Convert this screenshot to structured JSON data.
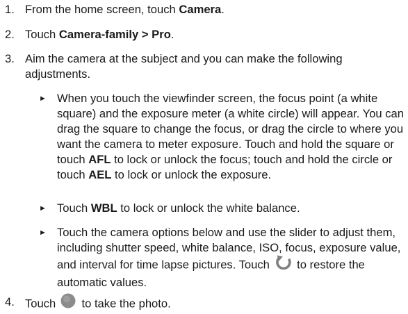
{
  "steps": [
    {
      "number": "1.",
      "t1": "From the home screen, touch ",
      "b1": "Camera",
      "t2": "."
    },
    {
      "number": "2.",
      "t1": "Touch ",
      "b1": "Camera-family > Pro",
      "t2": "."
    },
    {
      "number": "3.",
      "text": "Aim the camera at the subject and you can make the following adjustments."
    },
    {
      "number": "4.",
      "t1": "Touch ",
      "t2": " to take the photo.",
      "icon": "shutter-button-icon"
    }
  ],
  "bullets": [
    {
      "t1": "When you touch the viewfinder screen, the focus point (a white square) and the exposure meter (a white circle) will appear. You can drag the square to change the focus, or drag the circle to where you want the camera to meter exposure. Touch and hold the square or touch ",
      "b1": "AFL",
      "t2": " to lock or unlock the focus; touch and hold the circle or touch ",
      "b2": "AEL",
      "t3": " to lock or unlock the exposure."
    },
    {
      "t1": "Touch ",
      "b1": "WBL",
      "t2": " to lock or unlock the white balance."
    },
    {
      "t1": "Touch the camera options below and use the slider to adjust them, including shutter speed, white balance, ISO, focus, exposure value, and interval for time lapse pictures. Touch ",
      "t2": " to restore the automatic values.",
      "icon": "restore-auto-icon"
    }
  ],
  "bullet_glyph": "►",
  "colors": {
    "text": "#1a1a1a",
    "icon": "#808080"
  }
}
